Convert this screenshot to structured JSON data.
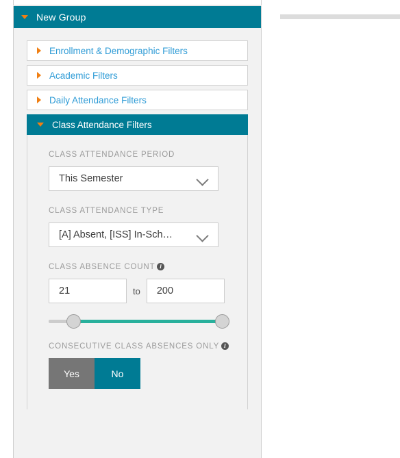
{
  "panel": {
    "group_header": {
      "title": "New Group",
      "caret_icon": "caret-down-icon"
    },
    "filters": [
      {
        "label": "Enrollment & Demographic Filters",
        "expanded": false
      },
      {
        "label": "Academic Filters",
        "expanded": false
      },
      {
        "label": "Daily Attendance Filters",
        "expanded": false
      },
      {
        "label": "Class Attendance Filters",
        "expanded": true
      }
    ],
    "class_attendance": {
      "period": {
        "label": "CLASS ATTENDANCE PERIOD",
        "value": "This Semester"
      },
      "type": {
        "label": "CLASS ATTENDANCE TYPE",
        "value": "[A] Absent, [ISS] In-Sch…"
      },
      "absence_count": {
        "label": "CLASS ABSENCE COUNT",
        "info": "i",
        "min_value": "21",
        "max_value": "200",
        "separator": "to",
        "slider": {
          "min": 0,
          "max": 200,
          "low": 21,
          "high": 200
        }
      },
      "consecutive": {
        "label": "CONSECUTIVE CLASS ABSENCES ONLY",
        "info": "i",
        "options": [
          {
            "label": "Yes",
            "selected": false
          },
          {
            "label": "No",
            "selected": true
          }
        ]
      }
    }
  },
  "colors": {
    "teal": "#007b94",
    "orange": "#f07f13",
    "link_blue": "#2e9bd6",
    "slider_green": "#28b09c",
    "gray_button": "#767676",
    "panel_bg": "#f2f2f2"
  }
}
